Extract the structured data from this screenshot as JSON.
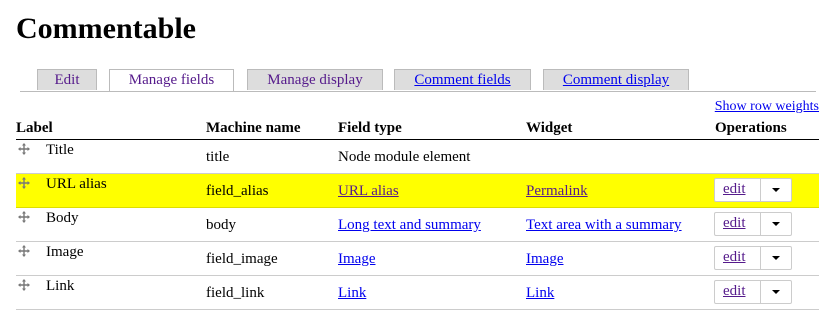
{
  "page": {
    "title": "Commentable"
  },
  "tabs": [
    {
      "label": "Edit"
    },
    {
      "label": "Manage fields"
    },
    {
      "label": "Manage display"
    },
    {
      "label": "Comment fields"
    },
    {
      "label": "Comment display"
    }
  ],
  "table": {
    "show_row_weights": "Show row weights",
    "headers": {
      "label": "Label",
      "machine_name": "Machine name",
      "field_type": "Field type",
      "widget": "Widget",
      "operations": "Operations"
    },
    "rows": [
      {
        "label": "Title",
        "machine_name": "title",
        "field_type": "Node module element",
        "widget": "",
        "edit": ""
      },
      {
        "label": "URL alias",
        "machine_name": "field_alias",
        "field_type": "URL alias",
        "widget": "Permalink",
        "edit": "edit",
        "highlighted": true
      },
      {
        "label": "Body",
        "machine_name": "body",
        "field_type": "Long text and summary",
        "widget": "Text area with a summary",
        "edit": "edit"
      },
      {
        "label": "Image",
        "machine_name": "field_image",
        "field_type": "Image",
        "widget": "Image",
        "edit": "edit"
      },
      {
        "label": "Link",
        "machine_name": "field_link",
        "field_type": "Link",
        "widget": "Link",
        "edit": "edit"
      }
    ]
  },
  "colors": {
    "highlight": "#ffff00",
    "link": "#0000ee",
    "visited_link": "#551a8b",
    "tab_background": "#dddddd"
  }
}
